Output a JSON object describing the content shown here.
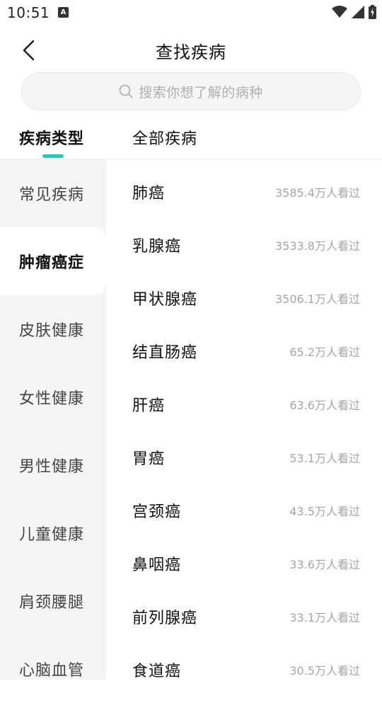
{
  "status_bar": {
    "time": "10:51",
    "notification_badge": "A"
  },
  "header": {
    "title": "查找疾病"
  },
  "search": {
    "placeholder": "搜索你想了解的病种"
  },
  "section": {
    "left_header": "疾病类型",
    "right_header": "全部疾病"
  },
  "categories": [
    {
      "label": "常见疾病"
    },
    {
      "label": "肿瘤癌症",
      "active": true
    },
    {
      "label": "皮肤健康"
    },
    {
      "label": "女性健康"
    },
    {
      "label": "男性健康"
    },
    {
      "label": "儿童健康"
    },
    {
      "label": "肩颈腰腿"
    },
    {
      "label": "心脑血管"
    }
  ],
  "diseases": [
    {
      "name": "肺癌",
      "views": "3585.4万人看过"
    },
    {
      "name": "乳腺癌",
      "views": "3533.8万人看过"
    },
    {
      "name": "甲状腺癌",
      "views": "3506.1万人看过"
    },
    {
      "name": "结直肠癌",
      "views": "65.2万人看过"
    },
    {
      "name": "肝癌",
      "views": "63.6万人看过"
    },
    {
      "name": "胃癌",
      "views": "53.1万人看过"
    },
    {
      "name": "宫颈癌",
      "views": "43.5万人看过"
    },
    {
      "name": "鼻咽癌",
      "views": "33.6万人看过"
    },
    {
      "name": "前列腺癌",
      "views": "33.1万人看过"
    },
    {
      "name": "食道癌",
      "views": "30.5万人看过"
    }
  ],
  "colors": {
    "accent": "#2fc4b5",
    "sidebar_bg": "#f5f5f5",
    "muted_text": "#a6a6a6"
  }
}
